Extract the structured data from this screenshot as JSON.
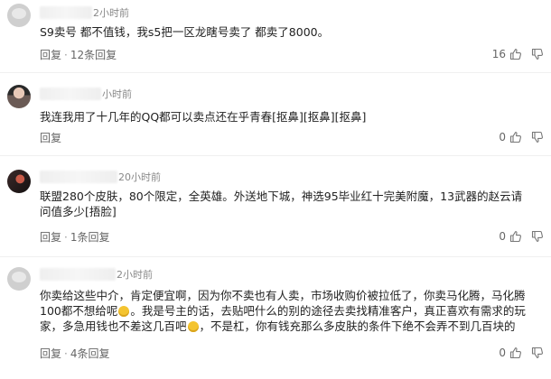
{
  "comments": [
    {
      "time": "2小时前",
      "text": "S9卖号 都不值钱，我s5把一区龙瞎号卖了 都卖了8000。",
      "reply_label": "回复",
      "replies_label": "12条回复",
      "likes": "16",
      "avatar": "grey"
    },
    {
      "time": "小时前",
      "text": "我连我用了十几年的QQ都可以卖点还在乎青春[抠鼻][抠鼻][抠鼻]",
      "reply_label": "回复",
      "replies_label": "",
      "likes": "0",
      "avatar": "photo"
    },
    {
      "time": "20小时前",
      "text": "联盟280个皮肤，80个限定，全英雄。外送地下城，神选95毕业红十完美附魔，13武器的赵云请问值多少[捂脸]",
      "reply_label": "回复",
      "replies_label": "1条回复",
      "likes": "0",
      "avatar": "dark"
    },
    {
      "time": "2小时前",
      "text_parts": [
        "你卖给这些中介，肯定便宜啊，因为你不卖也有人卖，市场收购价被拉低了，你卖马化腾，马化腾100都不想给呢",
        "。我是号主的话，去贴吧什么的别的途径去卖找精准客户，真正喜欢有需求的玩家，多急用钱也不差这几百吧",
        "，不是杠，你有钱充那么多皮肤的条件下绝不会弄不到几百块的"
      ],
      "reply_label": "回复",
      "replies_label": "4条回复",
      "likes": "0",
      "avatar": "grey"
    }
  ],
  "separator": "·",
  "colors": {
    "text": "#222222",
    "meta": "#888888",
    "action": "#666666"
  },
  "icons": [
    "thumb-up-icon",
    "thumb-down-icon"
  ]
}
